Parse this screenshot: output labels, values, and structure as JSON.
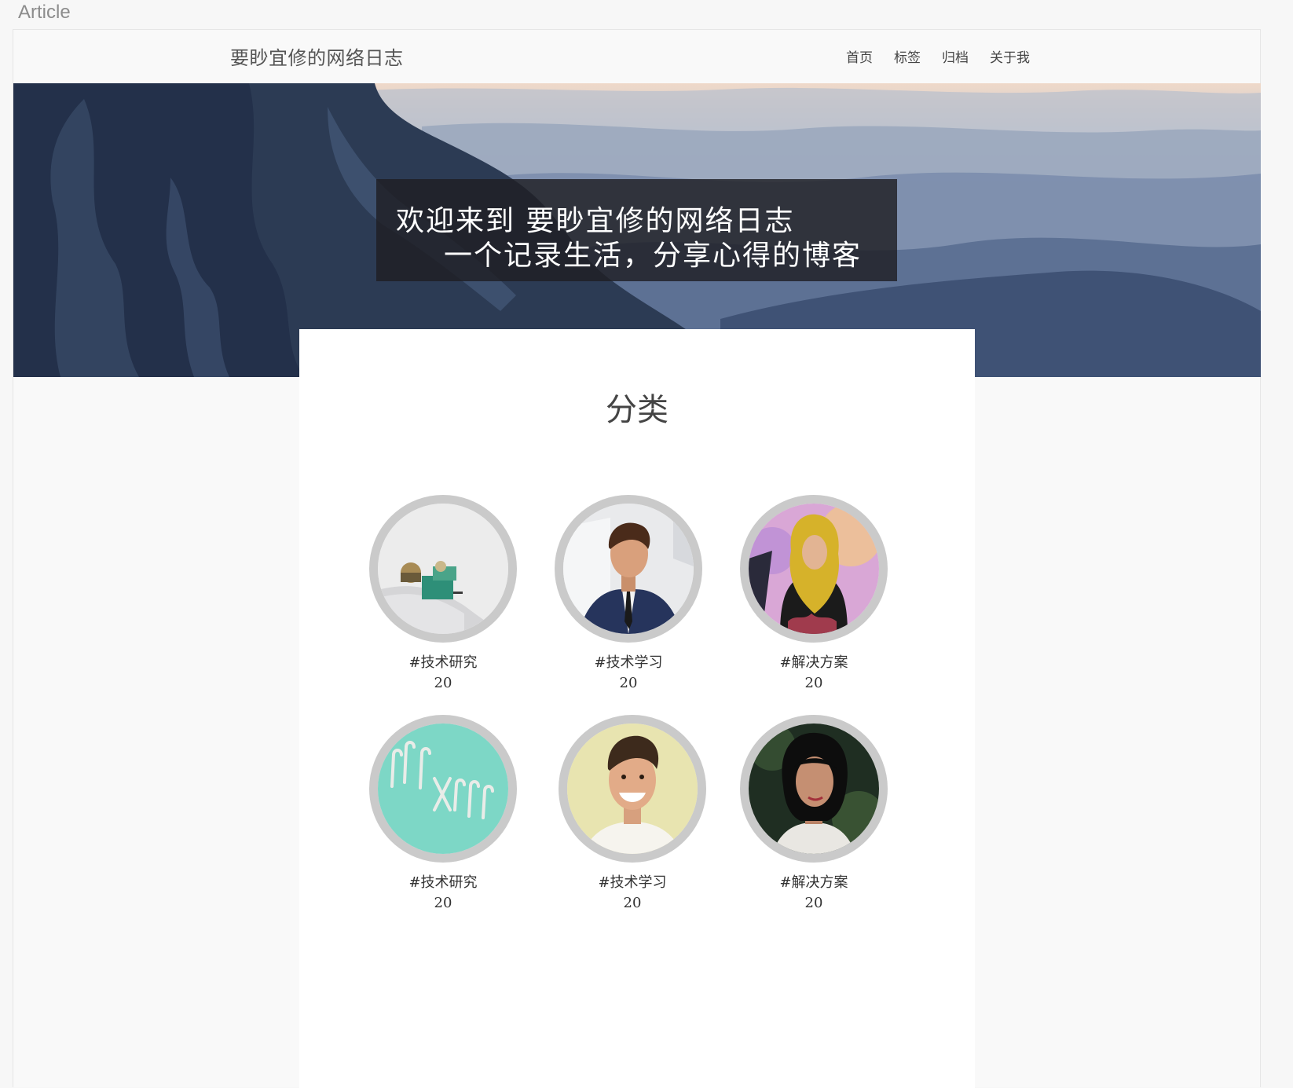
{
  "frame": {
    "label": "Article"
  },
  "navbar": {
    "site_title": "要眇宜修的网络日志",
    "links": [
      {
        "label": "首页"
      },
      {
        "label": "标签"
      },
      {
        "label": "归档"
      },
      {
        "label": "关于我"
      }
    ]
  },
  "hero": {
    "line1": "欢迎来到 要眇宜修的网络日志",
    "line2": "一个记录生活，分享心得的博客"
  },
  "categories_section": {
    "title": "分类",
    "items": [
      {
        "name": "#技术研究",
        "count": "20",
        "image": "observatory-on-snowy-hill"
      },
      {
        "name": "#技术学习",
        "count": "20",
        "image": "man-in-suit"
      },
      {
        "name": "#解决方案",
        "count": "20",
        "image": "woman-in-yellow-hijab"
      },
      {
        "name": "#技术研究",
        "count": "20",
        "image": "candy-canes-on-teal"
      },
      {
        "name": "#技术学习",
        "count": "20",
        "image": "smiling-man"
      },
      {
        "name": "#解决方案",
        "count": "20",
        "image": "woman-portrait-dark"
      }
    ]
  },
  "colors": {
    "page_bg": "#f9f9f9",
    "card_bg": "#ffffff",
    "avatar_ring": "#cacaca",
    "welcome_box": "#1e1f23"
  }
}
